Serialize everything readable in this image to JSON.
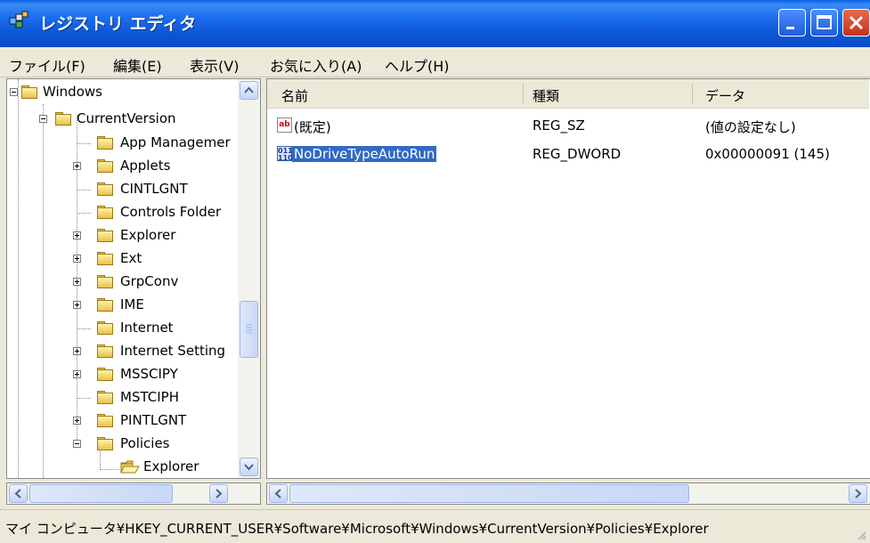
{
  "window": {
    "title": "レジストリ エディタ"
  },
  "menu": [
    "ファイル(F)",
    "編集(E)",
    "表示(V)",
    "お気に入り(A)",
    "ヘルプ(H)"
  ],
  "tree": {
    "items": [
      {
        "label": "Windows",
        "expander": "minus"
      },
      {
        "label": "CurrentVersion",
        "expander": "minus"
      },
      {
        "label": "App Managemer",
        "expander": "none"
      },
      {
        "label": "Applets",
        "expander": "plus"
      },
      {
        "label": "CINTLGNT",
        "expander": "none"
      },
      {
        "label": "Controls Folder",
        "expander": "none"
      },
      {
        "label": "Explorer",
        "expander": "plus"
      },
      {
        "label": "Ext",
        "expander": "plus"
      },
      {
        "label": "GrpConv",
        "expander": "plus"
      },
      {
        "label": "IME",
        "expander": "plus"
      },
      {
        "label": "Internet",
        "expander": "none"
      },
      {
        "label": "Internet Setting",
        "expander": "plus"
      },
      {
        "label": "MSSCIPY",
        "expander": "plus"
      },
      {
        "label": "MSTCIPH",
        "expander": "none"
      },
      {
        "label": "PINTLGNT",
        "expander": "plus"
      },
      {
        "label": "Policies",
        "expander": "minus"
      },
      {
        "label": "Explorer",
        "expander": "none",
        "open": true
      }
    ]
  },
  "list": {
    "columns": [
      "名前",
      "種類",
      "データ"
    ],
    "rows": [
      {
        "name": "(既定)",
        "type": "REG_SZ",
        "data": "(値の設定なし)",
        "icon": "string-value-icon"
      },
      {
        "name": "NoDriveTypeAutoRun",
        "type": "REG_DWORD",
        "data": "0x00000091 (145)",
        "icon": "binary-value-icon",
        "selected": true
      }
    ]
  },
  "status": {
    "path": "マイ コンピュータ¥HKEY_CURRENT_USER¥Software¥Microsoft¥Windows¥CurrentVersion¥Policies¥Explorer"
  },
  "colors": {
    "titlebar": "#0d56d8",
    "selection": "#316ac5",
    "close_button": "#c0331a"
  }
}
